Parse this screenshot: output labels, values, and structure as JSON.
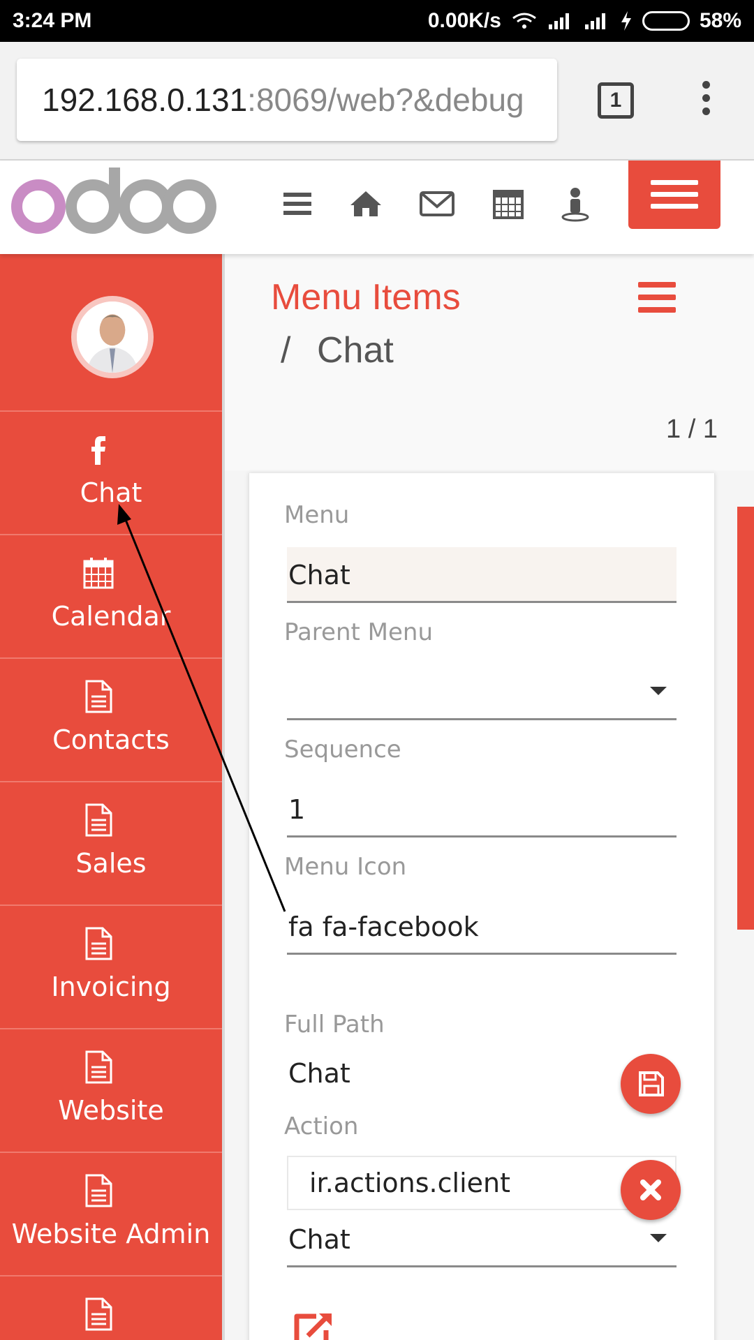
{
  "status_bar": {
    "time": "3:24 PM",
    "net_speed": "0.00K/s",
    "battery": "58%",
    "battery_level": 0.58
  },
  "browser": {
    "url_host": "192.168.0.131",
    "url_rest": ":8069/web?&debug",
    "tab_count": "1"
  },
  "header": {
    "icons": [
      "hamburger-icon",
      "home-icon",
      "envelope-icon",
      "calendar-icon",
      "user-icon"
    ]
  },
  "sidebar": {
    "items": [
      {
        "label": "Chat",
        "icon": "facebook-icon"
      },
      {
        "label": "Calendar",
        "icon": "calendar-icon"
      },
      {
        "label": "Contacts",
        "icon": "document-icon"
      },
      {
        "label": "Sales",
        "icon": "document-icon"
      },
      {
        "label": "Invoicing",
        "icon": "document-icon"
      },
      {
        "label": "Website",
        "icon": "document-icon"
      },
      {
        "label": "Website Admin",
        "icon": "document-icon"
      },
      {
        "label": "",
        "icon": "document-icon"
      }
    ]
  },
  "breadcrumb": {
    "parent": "Menu Items",
    "separator": "/",
    "current": "Chat"
  },
  "pager": "1 / 1",
  "form": {
    "menu_label": "Menu",
    "menu_value": "Chat",
    "parent_menu_label": "Parent Menu",
    "parent_menu_value": "",
    "sequence_label": "Sequence",
    "sequence_value": "1",
    "menu_icon_label": "Menu Icon",
    "menu_icon_value": "fa fa-facebook",
    "full_path_label": "Full Path",
    "full_path_value": "Chat",
    "action_label": "Action",
    "action_type_value": "ir.actions.client",
    "action_value": "Chat"
  },
  "colors": {
    "brand_red": "#e84c3d",
    "odoo_purple": "#c98cc4",
    "odoo_gray": "#a7a7a7"
  }
}
